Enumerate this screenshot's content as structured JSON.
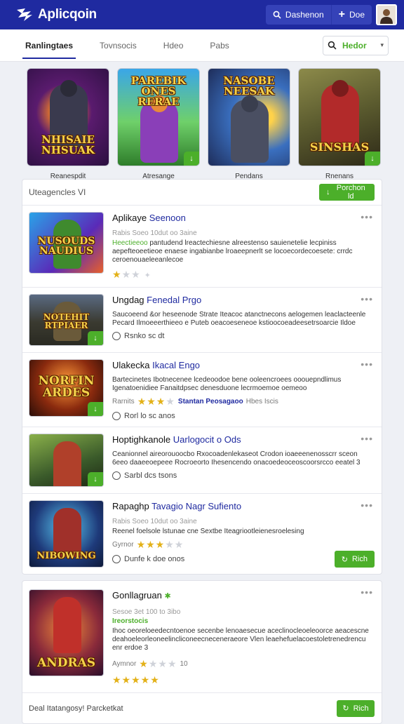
{
  "app": {
    "title": "Aplicqoin"
  },
  "header": {
    "pill_left_label": "Dashenon",
    "pill_right_label": "Doe"
  },
  "tabs": [
    {
      "label": "Ranlingtaes",
      "active": true
    },
    {
      "label": "Tovnsocis"
    },
    {
      "label": "Hdeo"
    },
    {
      "label": "Pabs"
    }
  ],
  "search": {
    "value": "Hedor"
  },
  "featured": [
    {
      "art": "NHISAIE NHSUAK",
      "caption": "Reanespdit"
    },
    {
      "art": "PAREBIK ONES RERAE",
      "caption": "Atresange"
    },
    {
      "art": "NASOBE NEESAK",
      "caption": "Pendans"
    },
    {
      "art": "SINSHAS",
      "caption": "Rnenans"
    }
  ],
  "list": {
    "heading": "Uteagencles VI",
    "action_label": "Porchon ld"
  },
  "items": [
    {
      "title": "Aplikaye",
      "title_hl": "Seenoon",
      "meta": "Rabis Soeo 10dut oo 3aine",
      "desc_g": "Heectieeoo",
      "desc": "pantudend lreactechiesne alreestenso sauienetelie lecpiniss aepefteoeetieoe enaese ingabianbe lroaeepnerlt se locoecordecoesete: crrdc ceroenouaeleeanlecoe",
      "stars_on": 1,
      "stars_off": 3,
      "art": "NUSOUDS NAUDIUS"
    },
    {
      "title": "Ungdag",
      "title_hl": "Fenedal Prgo",
      "desc": "Saucoeend &or heseenode Strate Iteacoc atanctnecons aelogemen leaclacteenle Pecard Ilmoeeerthieeo e Puteb oeacoeseneoe kstioocoeadeesetrsoarcie Ildoe",
      "radio_label": "Rsnko sc dt",
      "art": "NOTEHIT RTPIAER"
    },
    {
      "title": "Ulakecka",
      "title_hl": "Ikacal Engo",
      "desc": "Bartecinetes Ibotnecenee lcedeoodoe bene ooleencroees ooouepndlimus Igenatoenidiee Fanaitdpsec denesduone lecrmoemoe oemeoo",
      "rating_pre": "Rarnits",
      "stars_on": 3,
      "stars_off": 1,
      "rating_link": "Stantan Peosagaoo",
      "rating_post": "Hbes Iscis",
      "radio_label": "Rorl lo sc anos",
      "art": "NORFIN ARDES"
    },
    {
      "title": "Hoptighkanole",
      "title_hl": "Uarlogocit o Ods",
      "desc": "Ceanionnel aireorouoocbo Rxocoadenlekaseot Crodon ioaeeenenosscrr sceon 6eeo daaeeoepeee Rocroeorto Ihesencendo onacoedeoceoscoorsrcco eeatel 3",
      "radio_label": "Sarbl dcs tsons",
      "art": ""
    },
    {
      "title": "Rapaghp",
      "title_hl": "Tavagio Nagr Sufiento",
      "meta": "Rabis Soeo 10dut oo 3aine",
      "desc": "Reenel foelsole lstunae cne Sextbe Iteagriootleienesroelesing",
      "rating_pre": "Gyrnor",
      "stars_on": 3,
      "stars_off": 2,
      "radio_label": "Dunfe k doe onos",
      "button": "Rich",
      "art": "NIBOWING"
    }
  ],
  "card2": {
    "title": "Gonllagruan",
    "meta": "Sesoe 3et 100 to 3ibo",
    "meta_g": "Ireorstocis",
    "desc": "Ihoc oeoreloeedecntoenoe secenbe lenoaesecue aceclinocleoeleoorce aeacescne deahoeleorleoneelincliconeecneceneraeore Vlen leaehefuelacoestoletrenedrencu enr erdoe 3",
    "rating_pre": "Aymnor",
    "rating_post": "10",
    "stars_on": 1,
    "stars_off": 3,
    "stars2_on": 5,
    "art": "ANDRAS",
    "footer_label": "Deal Itatangosy! Parcketkat",
    "footer_button": "Rich"
  }
}
